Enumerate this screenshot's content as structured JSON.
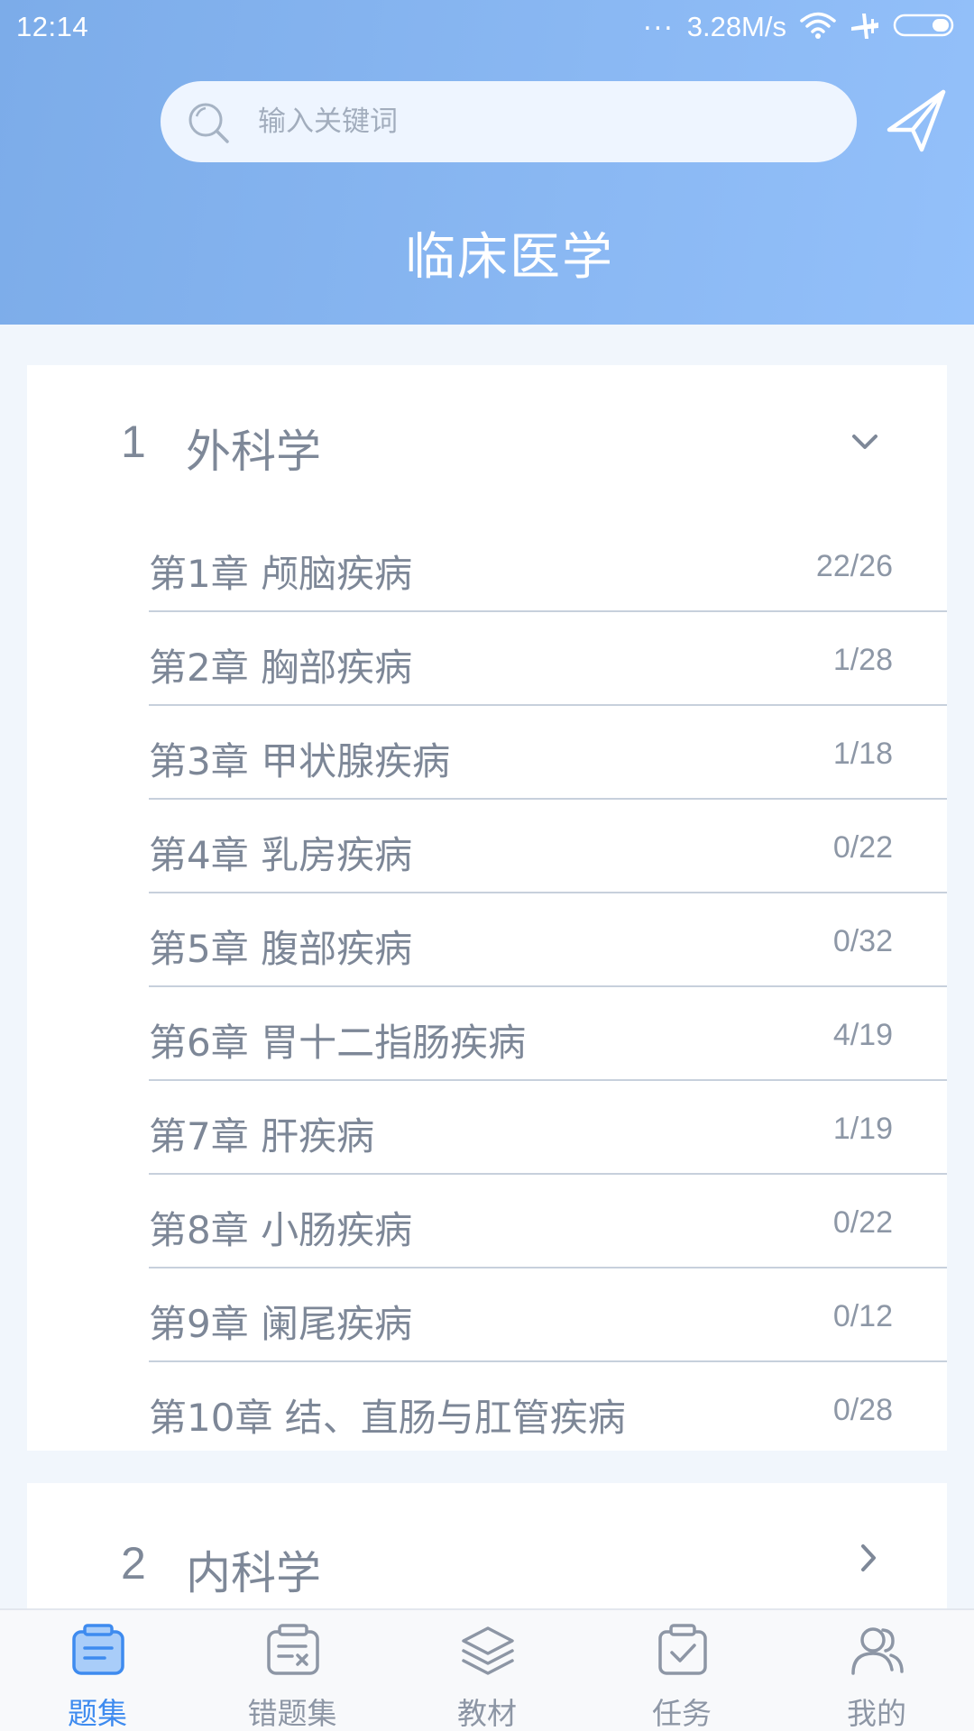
{
  "status_bar": {
    "time": "12:14",
    "dots": "...",
    "network_speed": "3.28M/s"
  },
  "search": {
    "placeholder": "输入关键词"
  },
  "header": {
    "title": "临床医学"
  },
  "sections": [
    {
      "number": "1",
      "name": "外科学",
      "chapters": [
        {
          "title": "第1章 颅脑疾病",
          "progress": "22/26"
        },
        {
          "title": "第2章 胸部疾病",
          "progress": "1/28"
        },
        {
          "title": "第3章 甲状腺疾病",
          "progress": "1/18"
        },
        {
          "title": "第4章 乳房疾病",
          "progress": "0/22"
        },
        {
          "title": "第5章 腹部疾病",
          "progress": "0/32"
        },
        {
          "title": "第6章 胃十二指肠疾病",
          "progress": "4/19"
        },
        {
          "title": "第7章 肝疾病",
          "progress": "1/19"
        },
        {
          "title": "第8章 小肠疾病",
          "progress": "0/22"
        },
        {
          "title": "第9章 阑尾疾病",
          "progress": "0/12"
        },
        {
          "title": "第10章 结、直肠与肛管疾病",
          "progress": "0/28"
        }
      ]
    },
    {
      "number": "2",
      "name": "内科学"
    }
  ],
  "tabs": [
    {
      "label": "题集",
      "icon": "question-set-icon",
      "active": true
    },
    {
      "label": "错题集",
      "icon": "wrong-questions-icon"
    },
    {
      "label": "教材",
      "icon": "layers-icon"
    },
    {
      "label": "任务",
      "icon": "task-clipboard-icon"
    },
    {
      "label": "我的",
      "icon": "user-group-icon"
    }
  ],
  "colors": {
    "header_start": "#7cace9",
    "header_end": "#93c0fa",
    "active_tab": "#3e8bef",
    "text": "#7d8797"
  }
}
